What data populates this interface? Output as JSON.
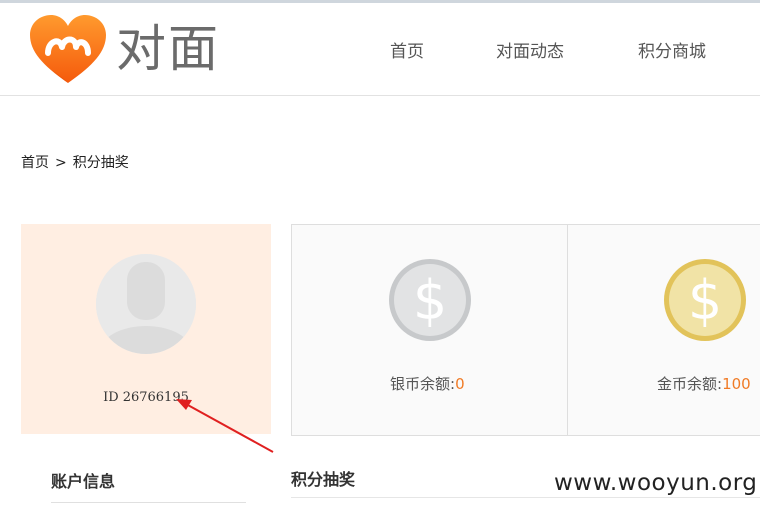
{
  "header": {
    "logo_text": "对面",
    "nav": {
      "home": "首页",
      "dynamics": "对面动态",
      "mall": "积分商城"
    }
  },
  "breadcrumb": {
    "home": "首页",
    "separator": ">",
    "current": "积分抽奖"
  },
  "profile": {
    "id_label": "ID",
    "id_value": "26766195"
  },
  "coins": {
    "silver": {
      "label": "银币余额:",
      "value": "0"
    },
    "gold": {
      "label": "金币余额:",
      "value": "100"
    }
  },
  "sections": {
    "account_info": "账户信息",
    "lottery": "积分抽奖"
  },
  "watermark": "www.wooyun.org",
  "colors": {
    "brand_orange": "#f07b26",
    "profile_bg": "#ffeee2",
    "annotation_red": "#e02020"
  }
}
